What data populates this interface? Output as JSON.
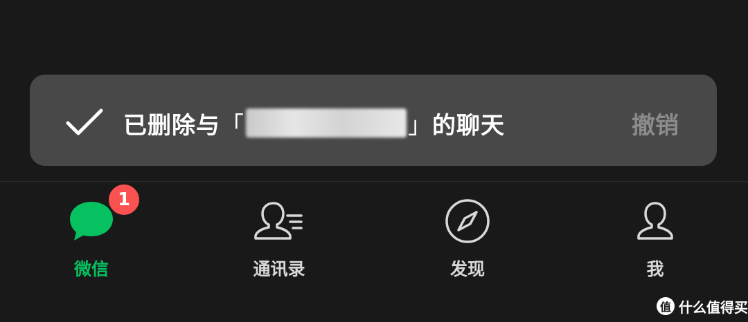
{
  "toast": {
    "icon": "check-icon",
    "message_prefix": "已删除与",
    "open_bracket": "「",
    "close_bracket": "」",
    "message_suffix": "的聊天",
    "undo_label": "撤销"
  },
  "tabbar": {
    "tabs": [
      {
        "label": "微信",
        "icon": "chat-bubble-icon",
        "active": true,
        "badge": "1"
      },
      {
        "label": "通讯录",
        "icon": "contacts-icon",
        "active": false
      },
      {
        "label": "发现",
        "icon": "compass-icon",
        "active": false
      },
      {
        "label": "我",
        "icon": "person-icon",
        "active": false
      }
    ]
  },
  "watermark": {
    "logo_char": "值",
    "text": "什么值得买"
  },
  "colors": {
    "accent": "#07c160",
    "badge": "#fa5151",
    "toast_bg": "#484848",
    "background": "#191919"
  }
}
